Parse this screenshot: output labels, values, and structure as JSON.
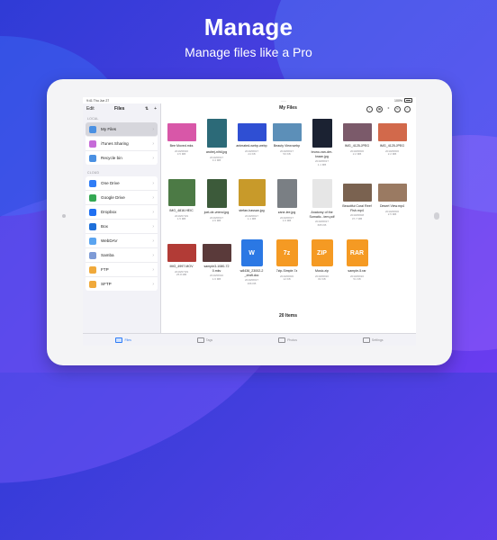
{
  "hero": {
    "title": "Manage",
    "subtitle": "Manage files like a Pro"
  },
  "status": {
    "time": "9:41",
    "date": "Thu Jun 27",
    "battery": "100%"
  },
  "sidebar": {
    "edit": "Edit",
    "title": "Files",
    "sort_icon": "sort-icon",
    "add_icon": "plus-icon",
    "local_label": "LOCAL",
    "cloud_label": "CLOUD",
    "local_items": [
      {
        "label": "My Files",
        "icon": "folder-icon",
        "color": "#4a90e2"
      },
      {
        "label": "iTunes Sharing",
        "icon": "music-note-icon",
        "color": "#c66bd8"
      },
      {
        "label": "Recycle bin",
        "icon": "trash-icon",
        "color": "#4a90e2"
      }
    ],
    "cloud_items": [
      {
        "label": "One Drive",
        "icon": "onedrive-icon",
        "color": "#2f7cf6"
      },
      {
        "label": "Google Drive",
        "icon": "google-drive-icon",
        "color": "#34a853"
      },
      {
        "label": "Dropbox",
        "icon": "dropbox-icon",
        "color": "#1f6ff2"
      },
      {
        "label": "Box",
        "icon": "box-icon",
        "color": "#1e6fd9"
      },
      {
        "label": "WebDAV",
        "icon": "webdav-icon",
        "color": "#5aa4f0"
      },
      {
        "label": "Samba",
        "icon": "samba-icon",
        "color": "#7e9bd6"
      },
      {
        "label": "FTP",
        "icon": "ftp-icon",
        "color": "#f0a93b"
      },
      {
        "label": "SFTP",
        "icon": "sftp-icon",
        "color": "#f0a93b"
      }
    ]
  },
  "main": {
    "title": "My Files",
    "items_count": "20 Items",
    "files": [
      {
        "name": "Bee Moved.mks",
        "date": "2019/08/20",
        "size": "3.5 MB",
        "kind": "wide",
        "color": "#d857a8"
      },
      {
        "name": "andrej-nihil.jpg",
        "date": "2019/08/27",
        "size": "3.4 MB",
        "kind": "tall",
        "color": "#2c6a78"
      },
      {
        "name": "animated-webp.webp",
        "date": "2019/08/27",
        "size": "24 KB",
        "kind": "wide",
        "color": "#2f4fd3"
      },
      {
        "name": "Beauty View.webp",
        "date": "2019/08/27",
        "size": "50 KB",
        "kind": "wide",
        "color": "#5c8fb8"
      },
      {
        "name": "bruno-van-der-kraan.jpg",
        "date": "2019/08/27",
        "size": "1.1 MB",
        "kind": "tall",
        "color": "#1b2232"
      },
      {
        "name": "IMG_4125.JPEG",
        "date": "2019/08/06",
        "size": "2.2 MB",
        "kind": "wide",
        "color": "#7b5a6a"
      },
      {
        "name": "IMG_4125.JPEG",
        "date": "2019/08/06",
        "size": "2.2 MB",
        "kind": "wide",
        "color": "#d2694b"
      },
      {
        "name": "IMG_4816.HEIC",
        "date": "2019/07/29",
        "size": "1.5 MB",
        "kind": "thumb",
        "color": "#4c7a45"
      },
      {
        "name": "joel-de-vriend.jpg",
        "date": "2019/08/27",
        "size": "2.6 MB",
        "kind": "tall",
        "color": "#3c5a3a"
      },
      {
        "name": "stefan-hassan.jpg",
        "date": "2019/08/27",
        "size": "1.1 MB",
        "kind": "thumb",
        "color": "#c89a2a"
      },
      {
        "name": "zane-lee.jpg",
        "date": "2019/08/27",
        "size": "1.6 MB",
        "kind": "tall",
        "color": "#7a7f84"
      },
      {
        "name": "Anatomy of the Somatic...tem.pdf",
        "date": "2019/08/27",
        "size": "665 KB",
        "kind": "tall",
        "color": "#e6e6e6"
      },
      {
        "name": "Beautiful Coral Reef Fish.mp4",
        "date": "2019/08/08",
        "size": "37.7 MB",
        "kind": "wide",
        "color": "#7a6250"
      },
      {
        "name": "Desert View.mp4",
        "date": "2019/08/06",
        "size": "2.5 MB",
        "kind": "wide",
        "color": "#9a7a62"
      },
      {
        "name": "IMG_4997.MOV",
        "date": "2019/07/29",
        "size": "25.8 MB",
        "kind": "wide",
        "color": "#b23b36"
      },
      {
        "name": "sample3-1080-72 0.mkv",
        "date": "2019/08/20",
        "size": "1.6 MB",
        "kind": "wide",
        "color": "#5a3a3a"
      },
      {
        "name": "w8436_23002-2 _draft.doc",
        "date": "2019/08/27",
        "size": "166 KB",
        "kind": "doc",
        "color": "#2b78e4",
        "badge": "W"
      },
      {
        "name": "7zip-Simple.7z",
        "date": "2019/08/06",
        "size": "12 KB",
        "kind": "doc",
        "color": "#f59a23",
        "badge": "7z"
      },
      {
        "name": "Music.zip",
        "date": "2019/08/20",
        "size": "82 KB",
        "kind": "doc",
        "color": "#f59a23",
        "badge": "ZIP"
      },
      {
        "name": "sample-5.rar",
        "date": "2019/08/20",
        "size": "51 KB",
        "kind": "doc",
        "color": "#f59a23",
        "badge": "RAR"
      }
    ]
  },
  "tabs": [
    {
      "label": "Files",
      "active": true
    },
    {
      "label": "Tags",
      "active": false
    },
    {
      "label": "Photos",
      "active": false
    },
    {
      "label": "Settings",
      "active": false
    }
  ]
}
